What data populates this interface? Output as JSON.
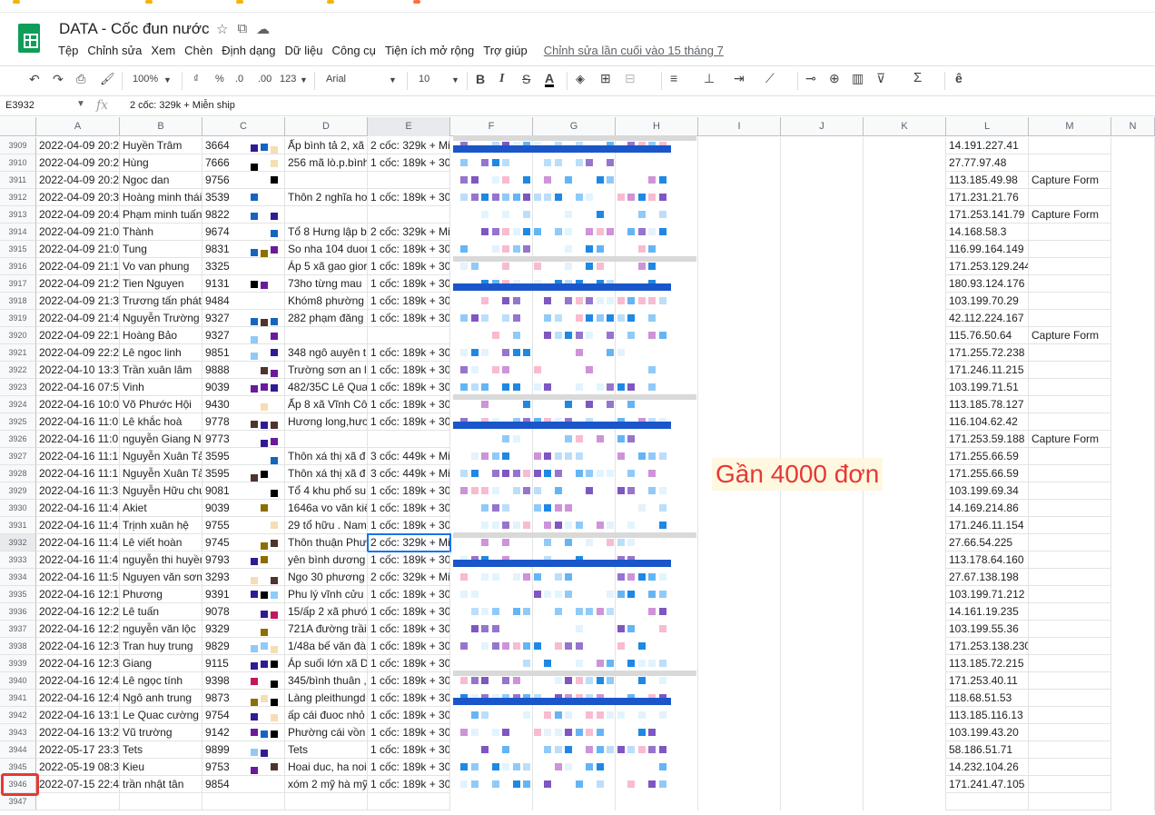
{
  "document": {
    "title": "DATA - Cốc đun nước",
    "star_icon": "star-icon",
    "folder_icon": "move-folder-icon",
    "cloud_icon": "cloud-status-icon"
  },
  "menu": {
    "items": [
      "Tệp",
      "Chỉnh sửa",
      "Xem",
      "Chèn",
      "Định dạng",
      "Dữ liệu",
      "Công cụ",
      "Tiện ích mở rộng",
      "Trợ giúp"
    ],
    "last_edit": "Chỉnh sửa lần cuối vào 15 tháng 7"
  },
  "toolbar": {
    "zoom": "100%",
    "currency": "₫",
    "percent": "%",
    "decimal_decrease": ".0",
    "decimal_increase": ".00",
    "format_more": "123",
    "font": "Arial",
    "font_size": "10",
    "bold": "B",
    "italic": "I",
    "strike": "S",
    "text_color": "A"
  },
  "formula_bar": {
    "name_box": "E3932",
    "fx": "fx",
    "value": "2 cốc: 329k + Miễn ship"
  },
  "columns": [
    "A",
    "B",
    "C",
    "D",
    "E",
    "F",
    "G",
    "H",
    "I",
    "J",
    "K",
    "L",
    "M",
    "N"
  ],
  "rows": [
    {
      "n": "3909",
      "a": "2022-04-09 20:2",
      "b": "Huyền Trâm",
      "c": "3664",
      "d": "Ấp bình tả 2, xã",
      "e": "2 cốc: 329k + Mi",
      "l": "14.191.227.41",
      "m": ""
    },
    {
      "n": "3910",
      "a": "2022-04-09 20:2",
      "b": "Hùng",
      "c": "7666",
      "d": "256 mã lò.p.bình",
      "e": "1 cốc: 189k + 30",
      "l": "27.77.97.48",
      "m": ""
    },
    {
      "n": "3911",
      "a": "2022-04-09 20:2",
      "b": "Ngoc dan",
      "c": "9756",
      "d": "",
      "e": "",
      "l": "113.185.49.98",
      "m": "Capture Form"
    },
    {
      "n": "3912",
      "a": "2022-04-09 20:3",
      "b": "Hoàng minh thái",
      "c": "3539",
      "d": "Thôn 2 nghĩa ho",
      "e": "1 cốc: 189k + 30",
      "l": "171.231.21.76",
      "m": ""
    },
    {
      "n": "3913",
      "a": "2022-04-09 20:4",
      "b": "Phạm minh tuấn",
      "c": "9822",
      "d": "",
      "e": "",
      "l": "171.253.141.79",
      "m": "Capture Form"
    },
    {
      "n": "3914",
      "a": "2022-04-09 21:0",
      "b": "Thành",
      "c": "9674",
      "d": "Tổ 8 Hưng lập b",
      "e": "2 cốc: 329k + Mi",
      "l": "14.168.58.3",
      "m": ""
    },
    {
      "n": "3915",
      "a": "2022-04-09 21:0",
      "b": "Tung",
      "c": "9831",
      "d": "So nha 104 duor",
      "e": "1 cốc: 189k + 30",
      "l": "116.99.164.149",
      "m": ""
    },
    {
      "n": "3916",
      "a": "2022-04-09 21:1",
      "b": "Vo van phung",
      "c": "3325",
      "d": "Áp 5 xã gao gior",
      "e": "1 cốc: 189k + 30",
      "l": "171.253.129.244",
      "m": ""
    },
    {
      "n": "3917",
      "a": "2022-04-09 21:2",
      "b": "Tien Nguyen",
      "c": "9131",
      "d": "73ho từng mau",
      "e": "1 cốc: 189k + 30",
      "l": "180.93.124.176",
      "m": ""
    },
    {
      "n": "3918",
      "a": "2022-04-09 21:3",
      "b": "Trương tấn phát",
      "c": "9484",
      "d": "Khóm8 phường",
      "e": "1 cốc: 189k + 30",
      "l": "103.199.70.29",
      "m": ""
    },
    {
      "n": "3919",
      "a": "2022-04-09 21:4",
      "b": "Nguyễn Trường",
      "c": "9327",
      "d": "282 phạm đăng",
      "e": "1 cốc: 189k + 30",
      "l": " 42.112.224.167",
      "m": ""
    },
    {
      "n": "3920",
      "a": "2022-04-09 22:1",
      "b": "Hoàng Bảo",
      "c": "9327",
      "d": "",
      "e": "",
      "l": "115.76.50.64",
      "m": "Capture Form"
    },
    {
      "n": "3921",
      "a": "2022-04-09 22:2",
      "b": "Lê ngoc linh",
      "c": "9851",
      "d": "348 ngô auyên t",
      "e": "1 cốc: 189k + 30",
      "l": "171.255.72.238",
      "m": ""
    },
    {
      "n": "3922",
      "a": "2022-04-10 13:3",
      "b": "Trần xuân lâm",
      "c": "9888",
      "d": "Trường sơn an l",
      "e": "1 cốc: 189k + 30",
      "l": "171.246.11.215",
      "m": ""
    },
    {
      "n": "3923",
      "a": "2022-04-16 07:5",
      "b": "Vinh",
      "c": "9039",
      "d": "482/35C Lê Qua",
      "e": "1 cốc: 189k + 30",
      "l": "103.199.71.51",
      "m": ""
    },
    {
      "n": "3924",
      "a": "2022-04-16 10:0",
      "b": "Võ Phước Hội",
      "c": "9430",
      "d": "Ấp 8 xã Vĩnh Cô",
      "e": "1 cốc: 189k + 30",
      "l": "113.185.78.127",
      "m": ""
    },
    {
      "n": "3925",
      "a": "2022-04-16 11:0",
      "b": "Lê khắc hoà",
      "c": "9778",
      "d": "Hương long,hươ",
      "e": "1 cốc: 189k + 30",
      "l": "116.104.62.42",
      "m": ""
    },
    {
      "n": "3926",
      "a": "2022-04-16 11:0",
      "b": "nguyễn Giang N",
      "c": "9773",
      "d": "",
      "e": "",
      "l": "171.253.59.188",
      "m": "Capture Form"
    },
    {
      "n": "3927",
      "a": "2022-04-16 11:1",
      "b": "Nguyễn Xuân Tả",
      "c": "3595",
      "d": "Thôn xá thị xã đ",
      "e": "3 cốc: 449k + Mi",
      "l": "171.255.66.59",
      "m": ""
    },
    {
      "n": "3928",
      "a": "2022-04-16 11:1",
      "b": "Nguyễn Xuân Tả",
      "c": "3595",
      "d": "Thôn xá thị xã đ",
      "e": "3 cốc: 449k + Mi",
      "l": "171.255.66.59",
      "m": ""
    },
    {
      "n": "3929",
      "a": "2022-04-16 11:3",
      "b": "Nguyễn Hữu chu",
      "c": "9081",
      "d": "Tổ 4 khu phố su",
      "e": "1 cốc: 189k + 30",
      "l": "103.199.69.34",
      "m": ""
    },
    {
      "n": "3930",
      "a": "2022-04-16 11:4",
      "b": "Akiet",
      "c": "9039",
      "d": "1646a vo văn kiệ",
      "e": "1 cốc: 189k + 30",
      "l": "14.169.214.86",
      "m": ""
    },
    {
      "n": "3931",
      "a": "2022-04-16 11:4",
      "b": "Trịnh xuân hệ",
      "c": "9755",
      "d": "29 tổ hữu . Nam",
      "e": "1 cốc: 189k + 30",
      "l": "171.246.11.154",
      "m": ""
    },
    {
      "n": "3932",
      "a": "2022-04-16 11:4",
      "b": "Lê viết hoàn",
      "c": "9745",
      "d": "Thôn thuận Phư",
      "e": "2 cốc: 329k + Mi",
      "l": "27.66.54.225",
      "m": ""
    },
    {
      "n": "3933",
      "a": "2022-04-16 11:4",
      "b": "nguyễn thi huyền",
      "c": "9793",
      "d": "yên bình dương",
      "e": "1 cốc: 189k + 30",
      "l": "113.178.64.160",
      "m": ""
    },
    {
      "n": "3934",
      "a": "2022-04-16 11:5",
      "b": "Nguyen văn sơn",
      "c": "3293",
      "d": "Ngo 30 phương",
      "e": "2 cốc: 329k + Mi",
      "l": "27.67.138.198",
      "m": ""
    },
    {
      "n": "3935",
      "a": "2022-04-16 12:1",
      "b": "Phương",
      "c": "9391",
      "d": "Phu lý vĩnh cửu",
      "e": "1 cốc: 189k + 30",
      "l": "103.199.71.212",
      "m": ""
    },
    {
      "n": "3936",
      "a": "2022-04-16 12:2",
      "b": "Lê tuấn",
      "c": "9078",
      "d": "15/ấp 2 xã phướ",
      "e": "1 cốc: 189k + 30",
      "l": "14.161.19.235",
      "m": ""
    },
    {
      "n": "3937",
      "a": "2022-04-16 12:2",
      "b": "nguyễn văn lộc",
      "c": "9329",
      "d": "721A đường trầi",
      "e": "1 cốc: 189k + 30",
      "l": "103.199.55.36",
      "m": ""
    },
    {
      "n": "3938",
      "a": "2022-04-16 12:3",
      "b": "Tran huy trung",
      "c": "9829",
      "d": "1/48a bế văn đà",
      "e": "1 cốc: 189k + 30",
      "l": "171.253.138.230",
      "m": ""
    },
    {
      "n": "3939",
      "a": "2022-04-16 12:3",
      "b": "Giang",
      "c": "9115",
      "d": "Áp suối lớn xã D",
      "e": "1 cốc: 189k + 30",
      "l": "113.185.72.215",
      "m": ""
    },
    {
      "n": "3940",
      "a": "2022-04-16 12:4",
      "b": "Lê ngọc tính",
      "c": "9398",
      "d": "345/bình thuân ,",
      "e": "1 cốc: 189k + 30",
      "l": "171.253.40.11",
      "m": ""
    },
    {
      "n": "3941",
      "a": "2022-04-16 12:4",
      "b": "Ngô anh trung",
      "c": "9873",
      "d": "Làng pleithungd",
      "e": "1 cốc: 189k + 30",
      "l": "118.68.51.53",
      "m": ""
    },
    {
      "n": "3942",
      "a": "2022-04-16 13:1",
      "b": "Le Quac cường",
      "c": "9754",
      "d": "ấp cái đuoc nhỏ",
      "e": "1 cốc: 189k + 30",
      "l": "113.185.116.13",
      "m": ""
    },
    {
      "n": "3943",
      "a": "2022-04-16 13:2",
      "b": "Vũ trường",
      "c": "9142",
      "d": "Phường cái vồn",
      "e": "1 cốc: 189k + 30",
      "l": "103.199.43.20",
      "m": ""
    },
    {
      "n": "3944",
      "a": "2022-05-17 23:3",
      "b": "Tets",
      "c": "9899",
      "d": "Tets",
      "e": "1 cốc: 189k + 30",
      "l": "58.186.51.71",
      "m": ""
    },
    {
      "n": "3945",
      "a": "2022-05-19 08:3",
      "b": "Kieu",
      "c": "9753",
      "d": "Hoai duc, ha noi",
      "e": "1 cốc: 189k + 30",
      "l": "14.232.104.26",
      "m": ""
    },
    {
      "n": "3946",
      "a": "2022-07-15 22:4",
      "b": "trần nhật tân",
      "c": "9854",
      "d": "xóm 2 mỹ hà mỹ",
      "e": "1 cốc: 189k + 30",
      "l": "171.241.47.105",
      "m": ""
    },
    {
      "n": "3947",
      "a": "",
      "b": "",
      "c": "",
      "d": "",
      "e": "",
      "l": "",
      "m": ""
    }
  ],
  "annotation": "Gần 4000 đơn",
  "colors": {
    "annotation_text": "#e53935",
    "highlight_box": "#e53935",
    "selection": "#1a73e8",
    "redact_blue": "#1a56c9"
  }
}
